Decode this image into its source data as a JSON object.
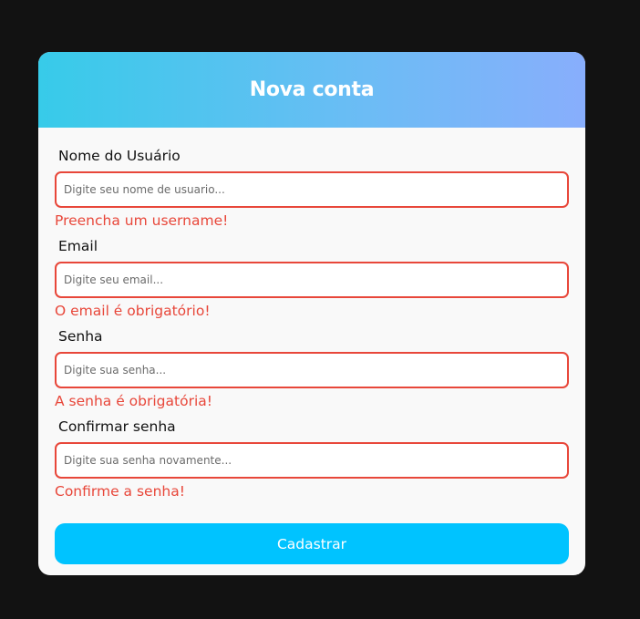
{
  "page": {
    "background": "#121212",
    "accent": "#00c3ff",
    "error_color": "#e8473a"
  },
  "header": {
    "title": "Nova conta",
    "gradient": [
      "#37cbe9",
      "#88aefc"
    ]
  },
  "form": {
    "username": {
      "label": "Nome do Usuário",
      "placeholder": "Digite seu nome de usuario...",
      "value": "",
      "error": "Preencha um username!"
    },
    "email": {
      "label": "Email",
      "placeholder": "Digite seu email...",
      "value": "",
      "error": "O email é obrigatório!"
    },
    "password": {
      "label": "Senha",
      "placeholder": "Digite sua senha...",
      "value": "",
      "error": "A senha é obrigatória!"
    },
    "confirm_password": {
      "label": "Confirmar senha",
      "placeholder": "Digite sua senha novamente...",
      "value": "",
      "error": "Confirme a senha!"
    },
    "submit_label": "Cadastrar"
  }
}
